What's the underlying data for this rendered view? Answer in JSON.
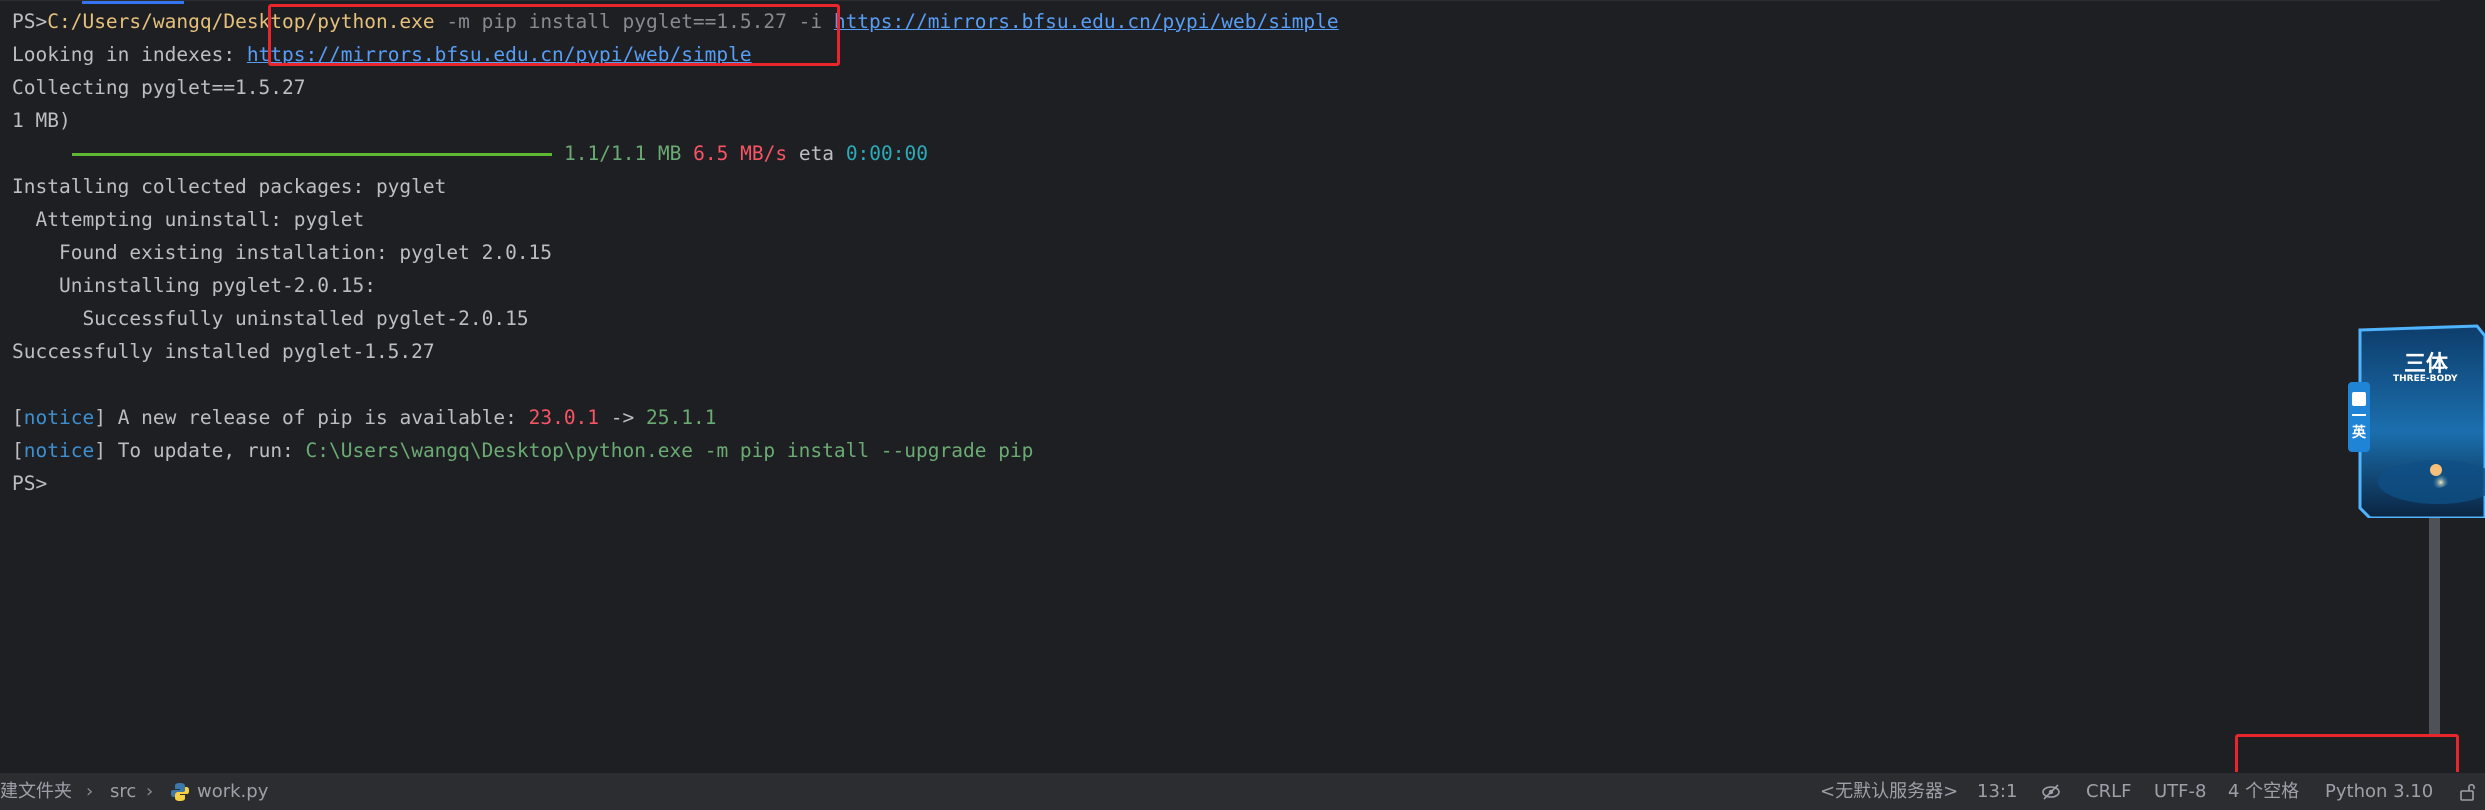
{
  "terminal": {
    "line1": {
      "prompt": "PS>",
      "exe_path": "C:/Users/wangq/Desktop/python.exe",
      "args": " -m pip install pyglet==1.5.27 -i ",
      "url": "https://mirrors.bfsu.edu.cn/pypi/web/simple"
    },
    "line2": {
      "label": "Looking in indexes: ",
      "url": "https://mirrors.bfsu.edu.cn/pypi/web/simple"
    },
    "line3": "Collecting pyglet==1.5.27",
    "line4": "1 MB)",
    "progress": {
      "fraction": 1.0,
      "size": "1.1/1.1 MB",
      "speed": "6.5 MB/s",
      "eta_label": "eta",
      "eta": "0:00:00"
    },
    "line6": "Installing collected packages: pyglet",
    "line7": "  Attempting uninstall: pyglet",
    "line8": "    Found existing installation: pyglet 2.0.15",
    "line9": "    Uninstalling pyglet-2.0.15:",
    "line10": "      Successfully uninstalled pyglet-2.0.15",
    "line11": "Successfully installed pyglet-1.5.27",
    "notice1": {
      "open": "[",
      "tag": "notice",
      "close": "]",
      "text": " A new release of pip is available: ",
      "old": "23.0.1",
      "arrow": " -> ",
      "new": "25.1.1"
    },
    "notice2": {
      "open": "[",
      "tag": "notice",
      "close": "]",
      "text": " To update, run: ",
      "cmd": "C:\\Users\\wangq\\Desktop\\python.exe -m pip install --upgrade pip"
    },
    "final_prompt": "PS>"
  },
  "widget": {
    "title": "三体",
    "subtitle": "THREE-BODY",
    "side_label": "英"
  },
  "statusbar": {
    "breadcrumb": {
      "folder": "建文件夹",
      "src": "src",
      "file": "work.py"
    },
    "server": "<无默认服务器>",
    "position": "13:1",
    "line_ending": "CRLF",
    "encoding": "UTF-8",
    "indent": "4 个空格",
    "interpreter": "Python 3.10"
  },
  "colors": {
    "highlight": "#e8262b",
    "progress": "#5fb832",
    "background": "#1e1f22"
  }
}
